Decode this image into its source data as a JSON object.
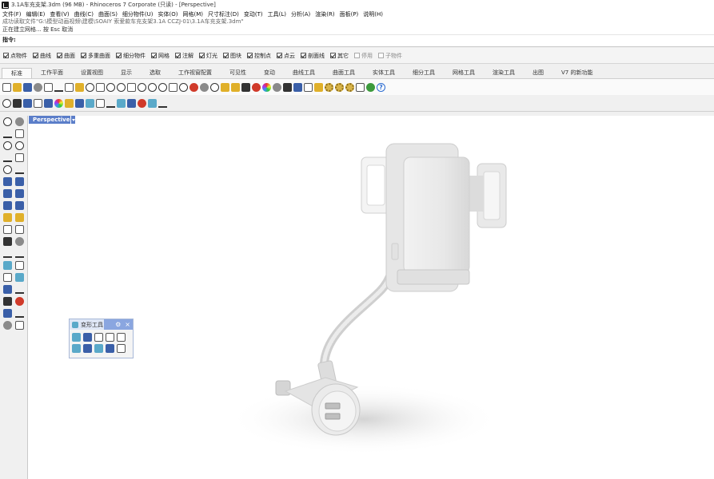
{
  "window": {
    "title": "3.1A车充支架.3dm (96 MB) - Rhinoceros 7 Corporate (只读) - [Perspective]"
  },
  "menu": [
    "文件(F)",
    "编辑(E)",
    "查看(V)",
    "曲线(C)",
    "曲面(S)",
    "细分物件(U)",
    "实体(O)",
    "网格(M)",
    "尺寸标注(D)",
    "变动(T)",
    "工具(L)",
    "分析(A)",
    "渲染(R)",
    "面板(P)",
    "说明(H)"
  ],
  "command": {
    "history1": "成功读取文件\"G:\\模型动画视频\\建模\\SOAIY 索爱款车充支架3.1A CCZJ-01\\3.1A车充支架.3dm\"",
    "history2": "正在建立网格... 按 Esc 取消",
    "prompt_label": "指令:",
    "input_value": ""
  },
  "osnaps": [
    {
      "label": "点物件",
      "checked": true
    },
    {
      "label": "曲线",
      "checked": true
    },
    {
      "label": "曲面",
      "checked": true
    },
    {
      "label": "多重曲面",
      "checked": true
    },
    {
      "label": "细分物件",
      "checked": true
    },
    {
      "label": "网格",
      "checked": true
    },
    {
      "label": "注解",
      "checked": true
    },
    {
      "label": "灯光",
      "checked": true
    },
    {
      "label": "图块",
      "checked": true
    },
    {
      "label": "控制点",
      "checked": true
    },
    {
      "label": "点云",
      "checked": true
    },
    {
      "label": "剖面线",
      "checked": true
    },
    {
      "label": "其它",
      "checked": true
    },
    {
      "label": "停用",
      "checked": false
    },
    {
      "label": "子物件",
      "checked": false
    }
  ],
  "tabs": [
    "标准",
    "工作平面",
    "设置视图",
    "显示",
    "选取",
    "工作视窗配置",
    "可见性",
    "变动",
    "曲线工具",
    "曲面工具",
    "实体工具",
    "细分工具",
    "网格工具",
    "渲染工具",
    "出图",
    "V7 的新功能"
  ],
  "active_tab": "标准",
  "viewport": {
    "label": "Perspective"
  },
  "float_panel": {
    "title": "变形工具"
  },
  "colors": {
    "accent": "#5b7ec9",
    "titlebar_bg": "#ffffff",
    "toolbar_bg": "#f0f0f0"
  }
}
